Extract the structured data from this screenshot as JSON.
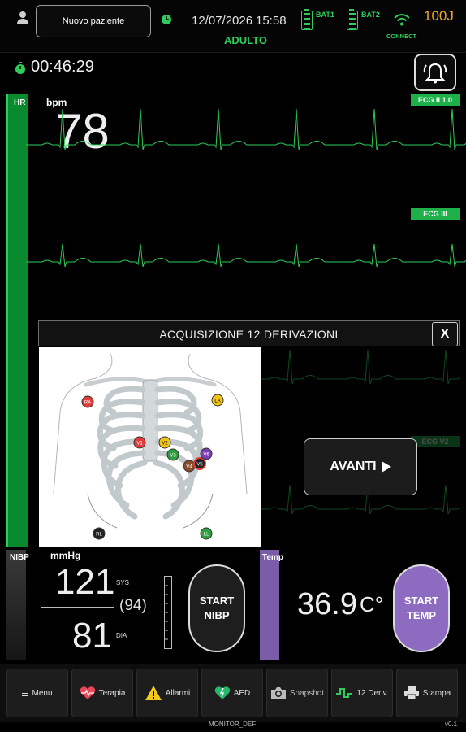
{
  "header": {
    "new_patient_label": "Nuovo paziente",
    "date": "12/07/2026",
    "time": "15:58",
    "mode": "ADULTO",
    "bat1": "BAT1",
    "bat2": "BAT2",
    "connect": "CONNECT",
    "energy": "100J"
  },
  "timer": {
    "elapsed": "00:46:29"
  },
  "hr": {
    "label": "HR",
    "unit": "bpm",
    "value": "78"
  },
  "ecg": {
    "lead1_tag": "ECG II  1.0",
    "lead2_tag": "ECG III",
    "lead3_tag": "ECG V2"
  },
  "modal": {
    "title": "ACQUISIZIONE 12 DERIVAZIONI",
    "close": "X",
    "next_label": "AVANTI",
    "electrodes": [
      "RA",
      "LA",
      "V1",
      "V2",
      "V3",
      "V4",
      "V5",
      "V6",
      "RL",
      "LL"
    ]
  },
  "nibp": {
    "label": "NIBP",
    "unit": "mmHg",
    "sys": "121",
    "sys_label": "SYS",
    "mean": "(94)",
    "dia": "81",
    "dia_label": "DIA",
    "button": "START NIBP"
  },
  "temp": {
    "label": "Temp",
    "value": "36.9",
    "unit": "C°",
    "button": "START TEMP"
  },
  "toolbar": {
    "menu": "Menu",
    "terapia": "Terapia",
    "allarmi": "Allarmi",
    "aed": "AED",
    "snapshot": "Snapshot",
    "deriv": "12 Deriv.",
    "stampa": "Stampa"
  },
  "footer": {
    "device": "MONITOR_DEF",
    "version": "v0.1"
  },
  "colors": {
    "accent_green": "#2ecc5a",
    "temp_purple": "#8c6bc0",
    "energy_orange": "#f5a623"
  }
}
